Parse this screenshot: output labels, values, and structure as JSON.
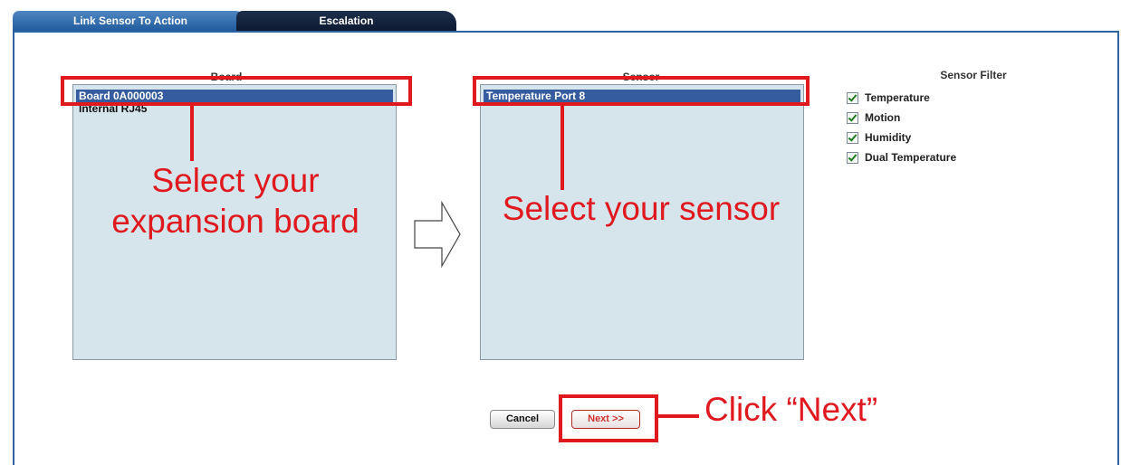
{
  "tabs": [
    {
      "label": "Link Sensor To Action"
    },
    {
      "label": "Escalation"
    }
  ],
  "board": {
    "label": "Board",
    "items": [
      "Board 0A000003",
      "Internal RJ45"
    ],
    "selected": "Board 0A000003"
  },
  "sensor": {
    "label": "Sensor",
    "items": [
      "Temperature Port 8"
    ],
    "selected": "Temperature Port 8"
  },
  "sensor_filter": {
    "title": "Sensor Filter",
    "options": [
      {
        "label": "Temperature",
        "checked": true
      },
      {
        "label": "Motion",
        "checked": true
      },
      {
        "label": "Humidity",
        "checked": true
      },
      {
        "label": "Dual Temperature",
        "checked": true
      }
    ]
  },
  "buttons": {
    "cancel": "Cancel",
    "next": "Next >>"
  },
  "annotations": {
    "board_line1": "Select your",
    "board_line2": "expansion board",
    "sensor": "Select your sensor",
    "next": "Click “Next”"
  },
  "colors": {
    "callout": "#e0191f",
    "selection": "#355c9f",
    "list_background": "#d6e5ec",
    "tab_active": "#1f5a9c"
  }
}
